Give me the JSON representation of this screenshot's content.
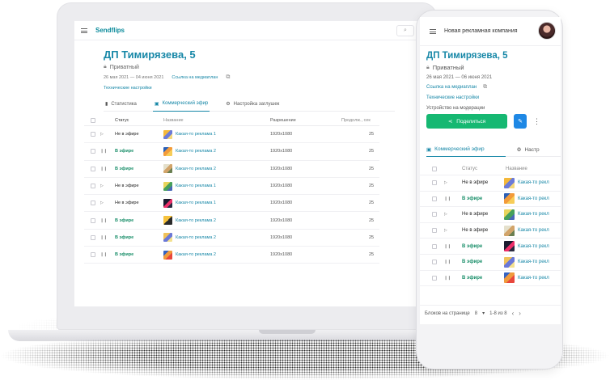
{
  "laptop": {
    "brand": "Sendflips",
    "search_icon": "search-icon",
    "title": "ДП Тимирязева, 5",
    "privacy": "Приватный",
    "dates": "26 мая 2021 — 04 июня 2021",
    "media_link": "Ссылка на медиаплан",
    "tech_settings": "Технические настройки",
    "tabs": [
      {
        "label": "Статистика",
        "icon": "chart-icon"
      },
      {
        "label": "Коммерческий эфир",
        "icon": "image-icon",
        "active": true
      },
      {
        "label": "Настройка заглушек",
        "icon": "gear-icon"
      }
    ],
    "columns": {
      "status": "Статус",
      "name": "Название",
      "resolution": "Разрешение",
      "duration": "Продолж., сек"
    },
    "rows": [
      {
        "control": "▷",
        "status": "Не в эфире",
        "on": false,
        "thumb": "t-a",
        "name": "Какая-то реклама 1",
        "resolution": "1920x1080",
        "duration": "25"
      },
      {
        "control": "❙❙",
        "status": "В эфире",
        "on": true,
        "thumb": "t-b",
        "name": "Какая-то реклама 2",
        "resolution": "1920x1080",
        "duration": "25"
      },
      {
        "control": "❙❙",
        "status": "В эфире",
        "on": true,
        "thumb": "t-c",
        "name": "Какая-то реклама 2",
        "resolution": "1920x1080",
        "duration": "25"
      },
      {
        "control": "▷",
        "status": "Не в эфире",
        "on": false,
        "thumb": "t-d",
        "name": "Какая-то реклама 1",
        "resolution": "1920x1080",
        "duration": "25"
      },
      {
        "control": "▷",
        "status": "Не в эфире",
        "on": false,
        "thumb": "t-e",
        "name": "Какая-то реклама 1",
        "resolution": "1920x1080",
        "duration": "25"
      },
      {
        "control": "❙❙",
        "status": "В эфире",
        "on": true,
        "thumb": "t-f",
        "name": "Какая-то реклама 2",
        "resolution": "1920x1080",
        "duration": "25"
      },
      {
        "control": "❙❙",
        "status": "В эфире",
        "on": true,
        "thumb": "t-g",
        "name": "Какая-то реклама 2",
        "resolution": "1920x1080",
        "duration": "25"
      },
      {
        "control": "❙❙",
        "status": "В эфире",
        "on": true,
        "thumb": "t-h",
        "name": "Какая-то реклама 2",
        "resolution": "1920x1080",
        "duration": "25"
      }
    ]
  },
  "phone": {
    "header_title": "Новая рекламная компания",
    "title": "ДП Тимирязева, 5",
    "privacy": "Приватный",
    "dates": "26 мая 2021 — 06 июня 2021",
    "media_link": "Ссылка на медиаплан",
    "tech_settings": "Технические настройки",
    "device_label": "Устройство на модерации",
    "share_label": "Поделиться",
    "tabs": [
      {
        "label": "Коммерческий эфир",
        "active": true
      },
      {
        "label": "Настр"
      }
    ],
    "columns": {
      "status": "Статус",
      "name": "Название"
    },
    "rows": [
      {
        "control": "▷",
        "status": "Не в эфире",
        "on": false,
        "thumb": "t-a",
        "name": "Какая-то рекл"
      },
      {
        "control": "❙❙",
        "status": "В эфире",
        "on": true,
        "thumb": "t-b",
        "name": "Какая-то рекл"
      },
      {
        "control": "▷",
        "status": "Не в эфире",
        "on": false,
        "thumb": "t-d",
        "name": "Какая-то рекл"
      },
      {
        "control": "▷",
        "status": "Не в эфире",
        "on": false,
        "thumb": "t-c",
        "name": "Какая-то рекл"
      },
      {
        "control": "❙❙",
        "status": "В эфире",
        "on": true,
        "thumb": "t-e",
        "name": "Какая-то рекл"
      },
      {
        "control": "❙❙",
        "status": "В эфире",
        "on": true,
        "thumb": "t-g",
        "name": "Какая-то рекл"
      },
      {
        "control": "❙❙",
        "status": "В эфире",
        "on": true,
        "thumb": "t-h",
        "name": "Какая-то рекл"
      }
    ],
    "footer": {
      "per_page_label": "Блоков на странице",
      "per_page_value": "8",
      "range": "1-8 из 8"
    },
    "colors": {
      "accent": "#1687a7",
      "on_air": "#1a8f6a",
      "share": "#16b872",
      "edit": "#1e88e5"
    }
  }
}
